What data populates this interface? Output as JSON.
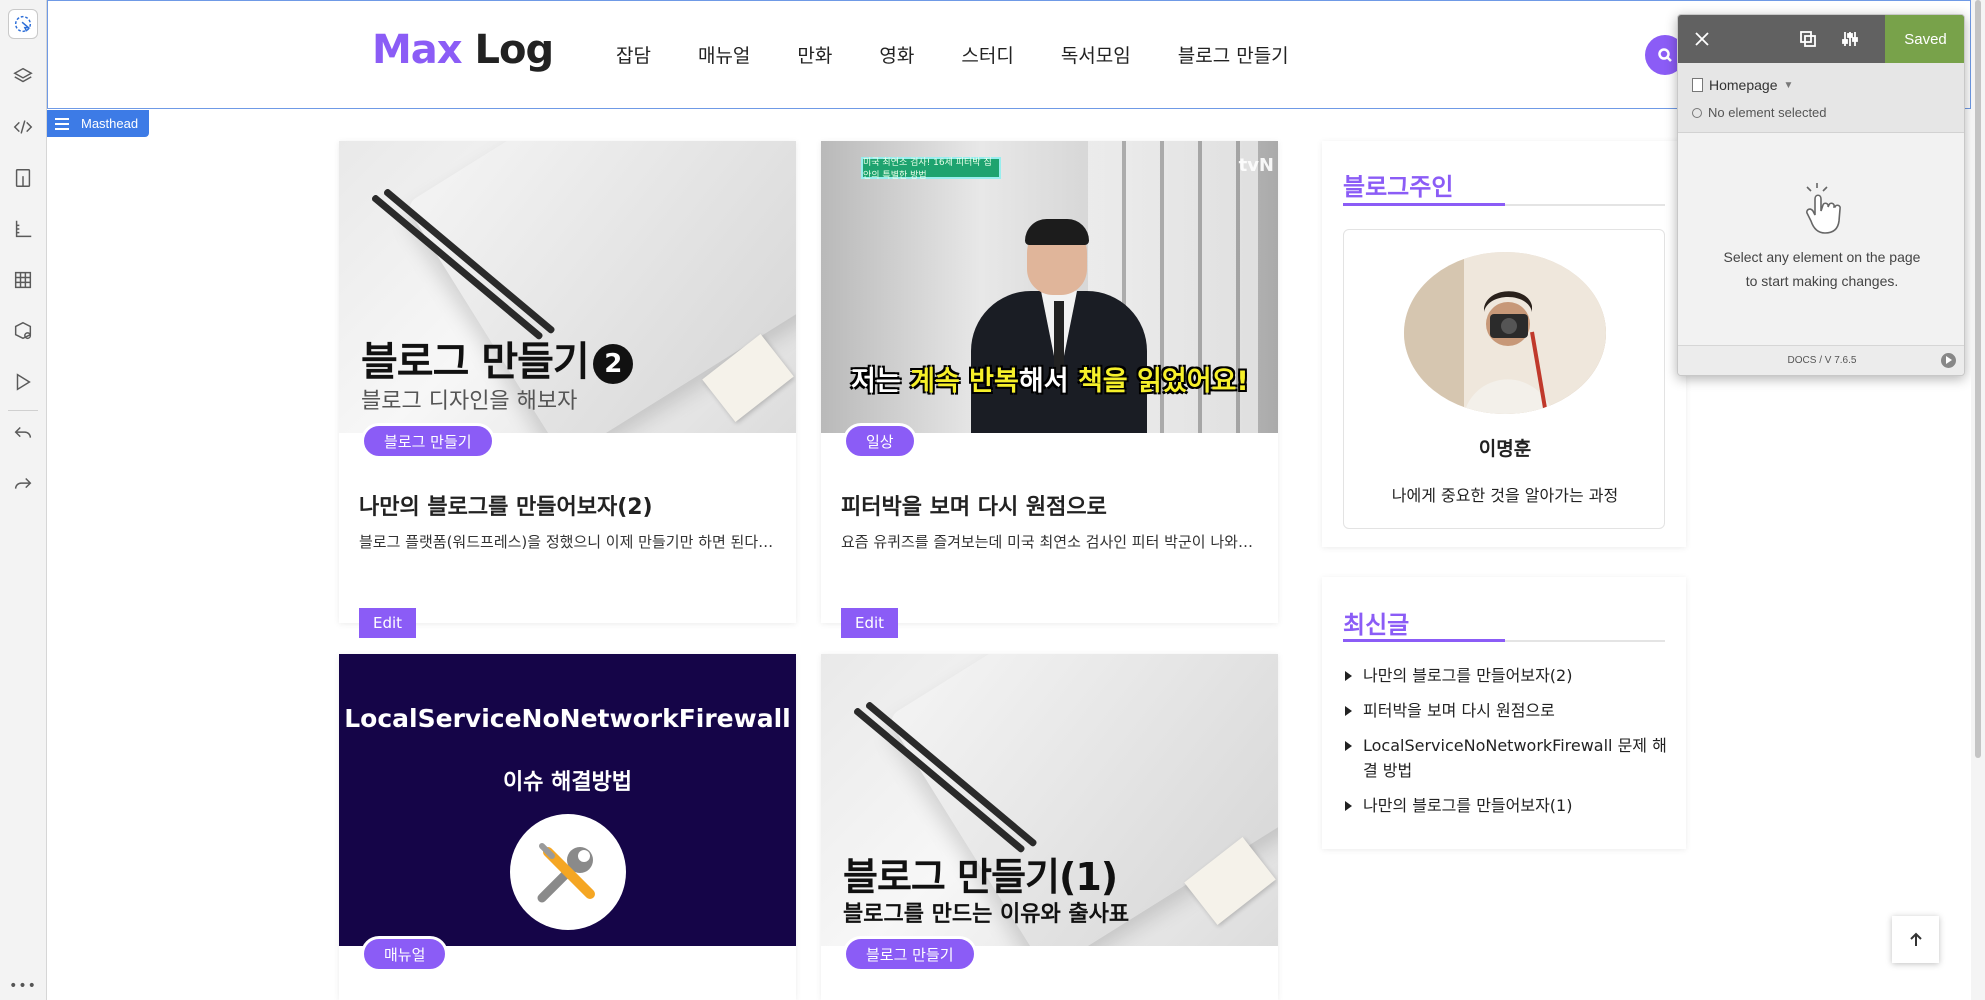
{
  "site": {
    "logo_max": "Max",
    "logo_log": "Log",
    "nav": [
      "잡담",
      "매뉴얼",
      "만화",
      "영화",
      "스터디",
      "독서모임",
      "블로그 만들기"
    ],
    "masthead_label": "Masthead",
    "accent_color": "#8b5cf6"
  },
  "posts": [
    {
      "image_title": "블로그 만들기",
      "image_number": "2",
      "image_subtitle": "블로그 디자인을 해보자",
      "category": "블로그 만들기",
      "title": "나만의 블로그를 만들어보자(2)",
      "excerpt": "블로그 플랫폼(워드프레스)을 정했으니 이제 만들기만 하면 된다. 블로그 디자인을",
      "edit_label": "Edit"
    },
    {
      "image_badge": "미국 최연소 검사! 16세 피터박 집안의 특별한 방법",
      "image_brand": "tvN",
      "image_caption_1": "저는 ",
      "image_caption_hl1": "계속 반복",
      "image_caption_2": "해서 ",
      "image_caption_hl2": "책을 읽었어요!",
      "category": "일상",
      "title": "피터박을 보며 다시 원점으로",
      "excerpt": "요즘 유퀴즈를 즐겨보는데 미국 최연소 검사인 피터 박군이 나와서 이야기를 했다.",
      "edit_label": "Edit"
    },
    {
      "image_title": "LocalServiceNoNetworkFirewall",
      "image_subtitle": "이슈 해결방법",
      "category": "매뉴얼"
    },
    {
      "image_title": "블로그 만들기(1)",
      "image_subtitle": "블로그를 만드는 이유와 출사표",
      "category": "블로그 만들기"
    }
  ],
  "sidebar": {
    "owner_title": "블로그주인",
    "owner_name": "이명훈",
    "owner_desc": "나에게 중요한 것을 알아가는 과정",
    "recent_title": "최신글",
    "recent": [
      "나만의 블로그를 만들어보자(2)",
      "피터박을 보며 다시 원점으로",
      "LocalServiceNoNetworkFirewall 문제 해결 방법",
      "나만의 블로그를 만들어보자(1)"
    ]
  },
  "editor_panel": {
    "saved_label": "Saved",
    "page_name": "Homepage",
    "selection_status": "No element selected",
    "message_line1": "Select any element on the page",
    "message_line2": "to start making changes.",
    "docs_version": "DOCS / V 7.6.5",
    "saved_color": "#78a24a"
  },
  "toolbar_icons": [
    "select-icon",
    "layers-icon",
    "code-icon",
    "page-icon",
    "ruler-icon",
    "grid-icon",
    "components-icon",
    "preview-icon",
    "undo-icon",
    "redo-icon",
    "more-icon"
  ]
}
